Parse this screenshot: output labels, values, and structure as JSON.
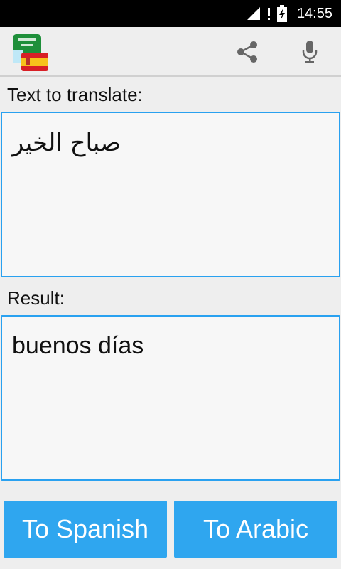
{
  "status_bar": {
    "time": "14:55",
    "icons": [
      "signal-icon",
      "alert-icon",
      "battery-charging-icon"
    ]
  },
  "app_bar": {
    "logo": "arabic-spanish-flags-logo",
    "actions": [
      "share-icon",
      "microphone-icon"
    ]
  },
  "input": {
    "label": "Text to translate:",
    "value": "صباح الخير"
  },
  "result": {
    "label": "Result:",
    "value": "buenos días"
  },
  "buttons": {
    "to_spanish": "To Spanish",
    "to_arabic": "To Arabic"
  },
  "colors": {
    "accent": "#29a1f0",
    "button_bg": "#2fa6ef",
    "background": "#eeeeee",
    "status_bar": "#000000"
  }
}
